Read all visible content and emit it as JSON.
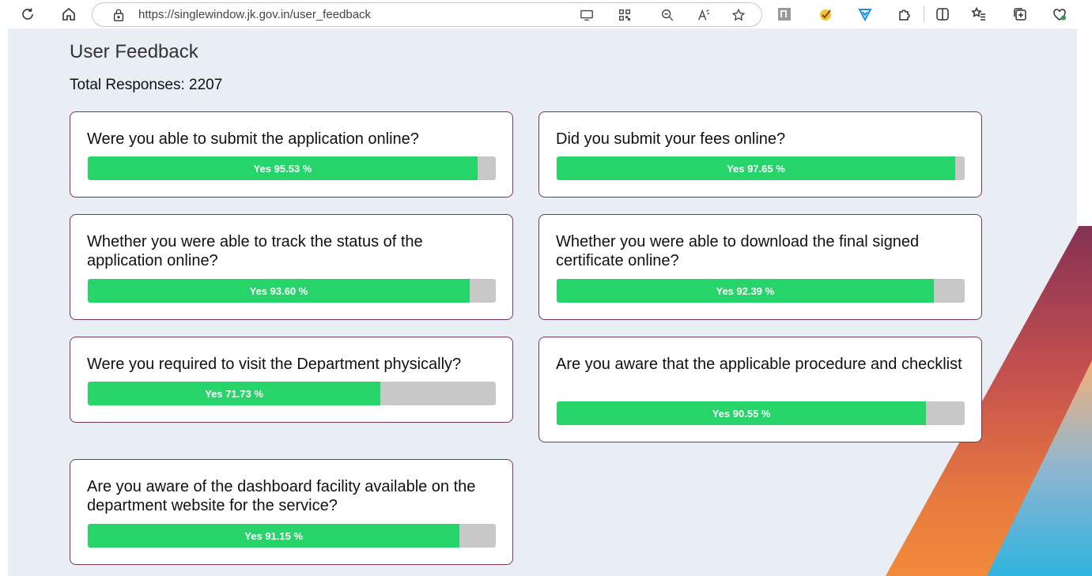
{
  "browser": {
    "url": "https://singlewindow.jk.gov.in/user_feedback",
    "icons": [
      "refresh-icon",
      "home-icon",
      "lock-icon",
      "app-available-icon",
      "qr-code-icon",
      "zoom-out-icon",
      "read-aloud-icon",
      "favorite-star-icon",
      "extension-icon",
      "checkmark-extension-icon",
      "shield-extension-icon",
      "puzzle-icon",
      "split-screen-icon",
      "favorites-bar-icon",
      "collections-icon",
      "browser-essentials-icon"
    ]
  },
  "page": {
    "title": "User Feedback",
    "total_responses": "Total Responses: 2207"
  },
  "questions": [
    {
      "text": "Were you able to submit the application online?",
      "label": "Yes 95.53 %",
      "yes_percent": 95.53
    },
    {
      "text": "Did you submit your fees online?",
      "label": "Yes 97.65 %",
      "yes_percent": 97.65
    },
    {
      "text": "Whether you were able to track the status of the application online?",
      "label": "Yes 93.60 %",
      "yes_percent": 93.6
    },
    {
      "text": "Whether you were able to download the final signed certificate online?",
      "label": "Yes 92.39 %",
      "yes_percent": 92.39
    },
    {
      "text": "Were you required to visit the Department physically?",
      "label": "Yes 71.73 %",
      "yes_percent": 71.73
    },
    {
      "text": "Are you aware that the applicable procedure and checklist",
      "label": "Yes 90.55 %",
      "yes_percent": 90.55
    },
    {
      "text": "Are you aware of the dashboard facility available on the department website for the service?",
      "label": "Yes 91.15 %",
      "yes_percent": 91.15
    }
  ],
  "colors": {
    "bar_fill": "#27d46a",
    "bar_track": "#c8c8c8",
    "card_border": "#7b3560",
    "page_bg": "#e9eef4"
  }
}
